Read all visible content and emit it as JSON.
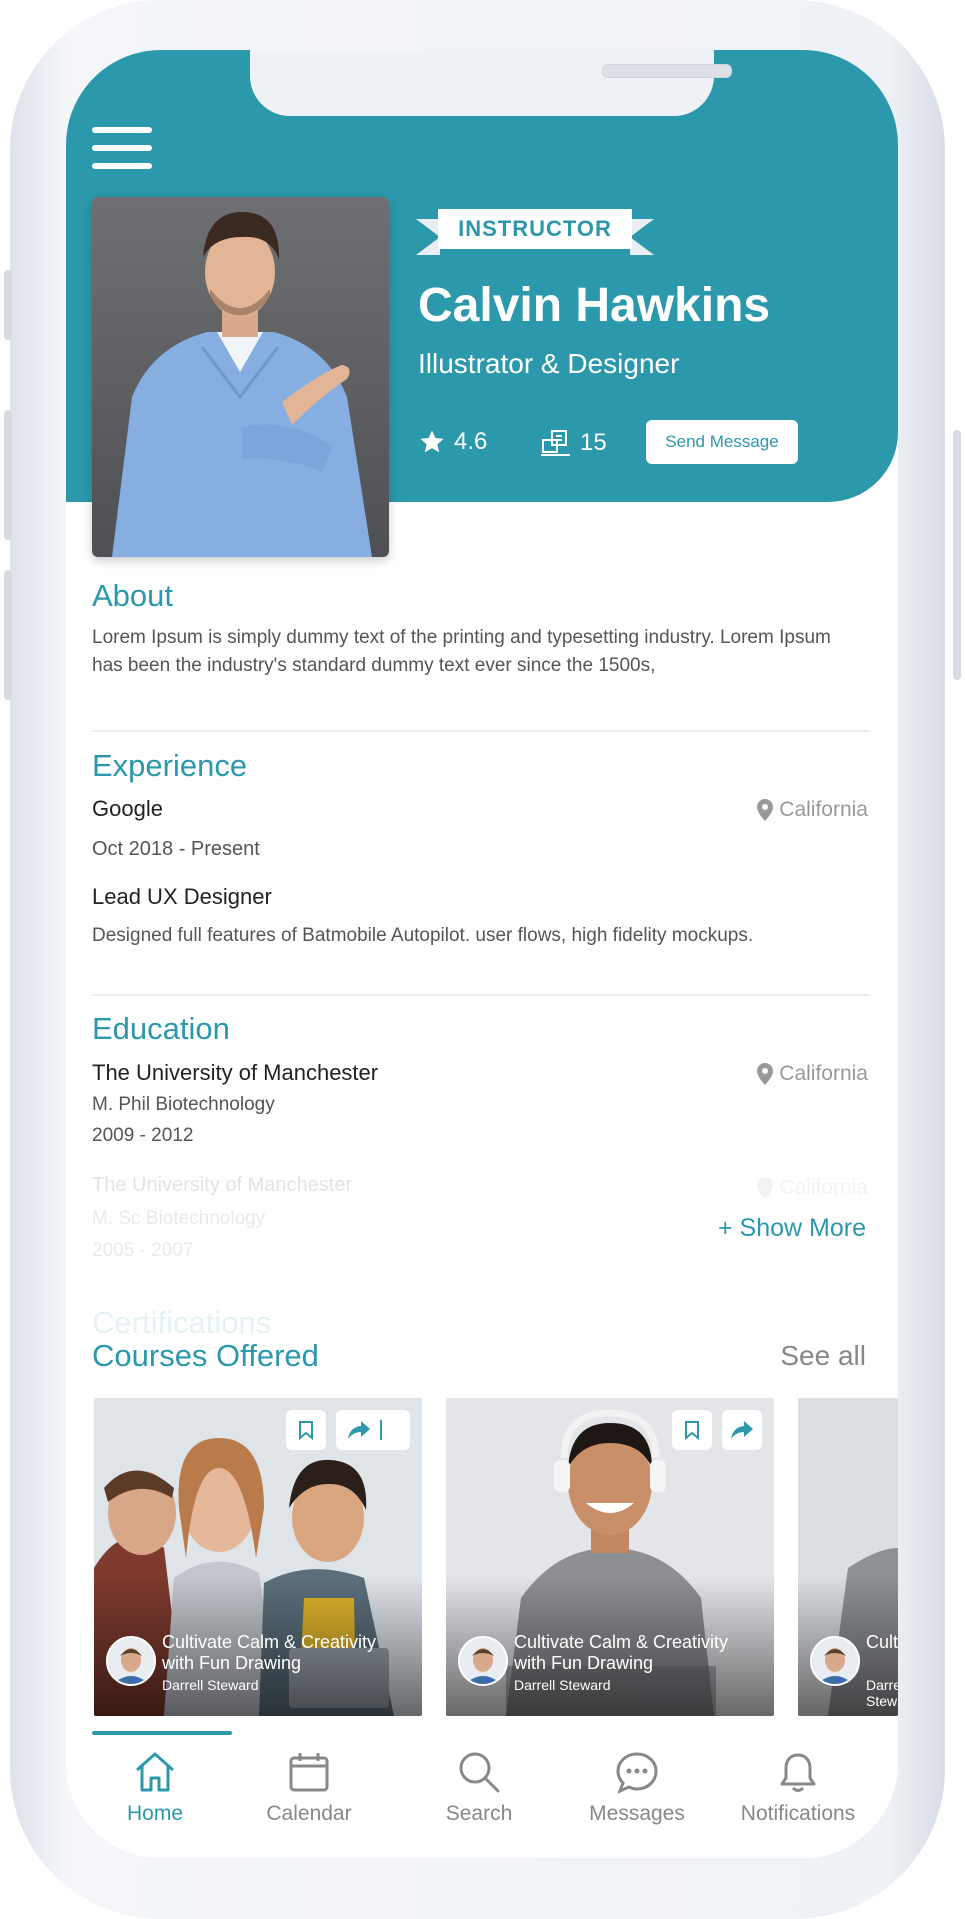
{
  "profile": {
    "badge": "INSTRUCTOR",
    "name": "Calvin Hawkins",
    "role": "Illustrator & Designer",
    "rating": "4.6",
    "courses_count": "15",
    "send_message_label": "Send Message"
  },
  "about": {
    "title": "About",
    "text": "Lorem Ipsum is simply dummy text of the printing and typesetting industry. Lorem Ipsum has been the industry's standard dummy text ever since the 1500s,"
  },
  "experience": {
    "title": "Experience",
    "company": "Google",
    "location": "California",
    "period": "Oct 2018 - Present",
    "position": "Lead UX Designer",
    "description": "Designed full features of Batmobile Autopilot. user flows, high fidelity mockups."
  },
  "education": {
    "title": "Education",
    "items": [
      {
        "school": "The University of Manchester",
        "degree": "M. Phil Biotechnology",
        "years": "2009 - 2012",
        "location": "California"
      },
      {
        "school": "The University of Manchester",
        "degree": "M. Sc Biotechnology",
        "years": "2005 - 2007",
        "location": "California"
      }
    ],
    "show_more_label": "+ Show More"
  },
  "certifications": {
    "title": "Certifications"
  },
  "courses": {
    "title": "Courses Offered",
    "see_all_label": "See all",
    "items": [
      {
        "title": "Cultivate Calm & Creativity with Fun Drawing",
        "author": "Darrell Steward"
      },
      {
        "title": "Cultivate Calm & Creativity with Fun Drawing",
        "author": "Darrell Steward"
      },
      {
        "title": "Cultivate Calm & Creativity with Fun Drawing",
        "author": "Darrell Steward"
      }
    ]
  },
  "tabs": [
    {
      "label": "Home",
      "icon": "home-icon",
      "active": true
    },
    {
      "label": "Calendar",
      "icon": "calendar-icon",
      "active": false
    },
    {
      "label": "Search",
      "icon": "search-icon",
      "active": false
    },
    {
      "label": "Messages",
      "icon": "messages-icon",
      "active": false
    },
    {
      "label": "Notifications",
      "icon": "bell-icon",
      "active": false
    }
  ],
  "colors": {
    "accent": "#2c98ab",
    "text_dark": "#222222",
    "text_muted": "#888888"
  }
}
